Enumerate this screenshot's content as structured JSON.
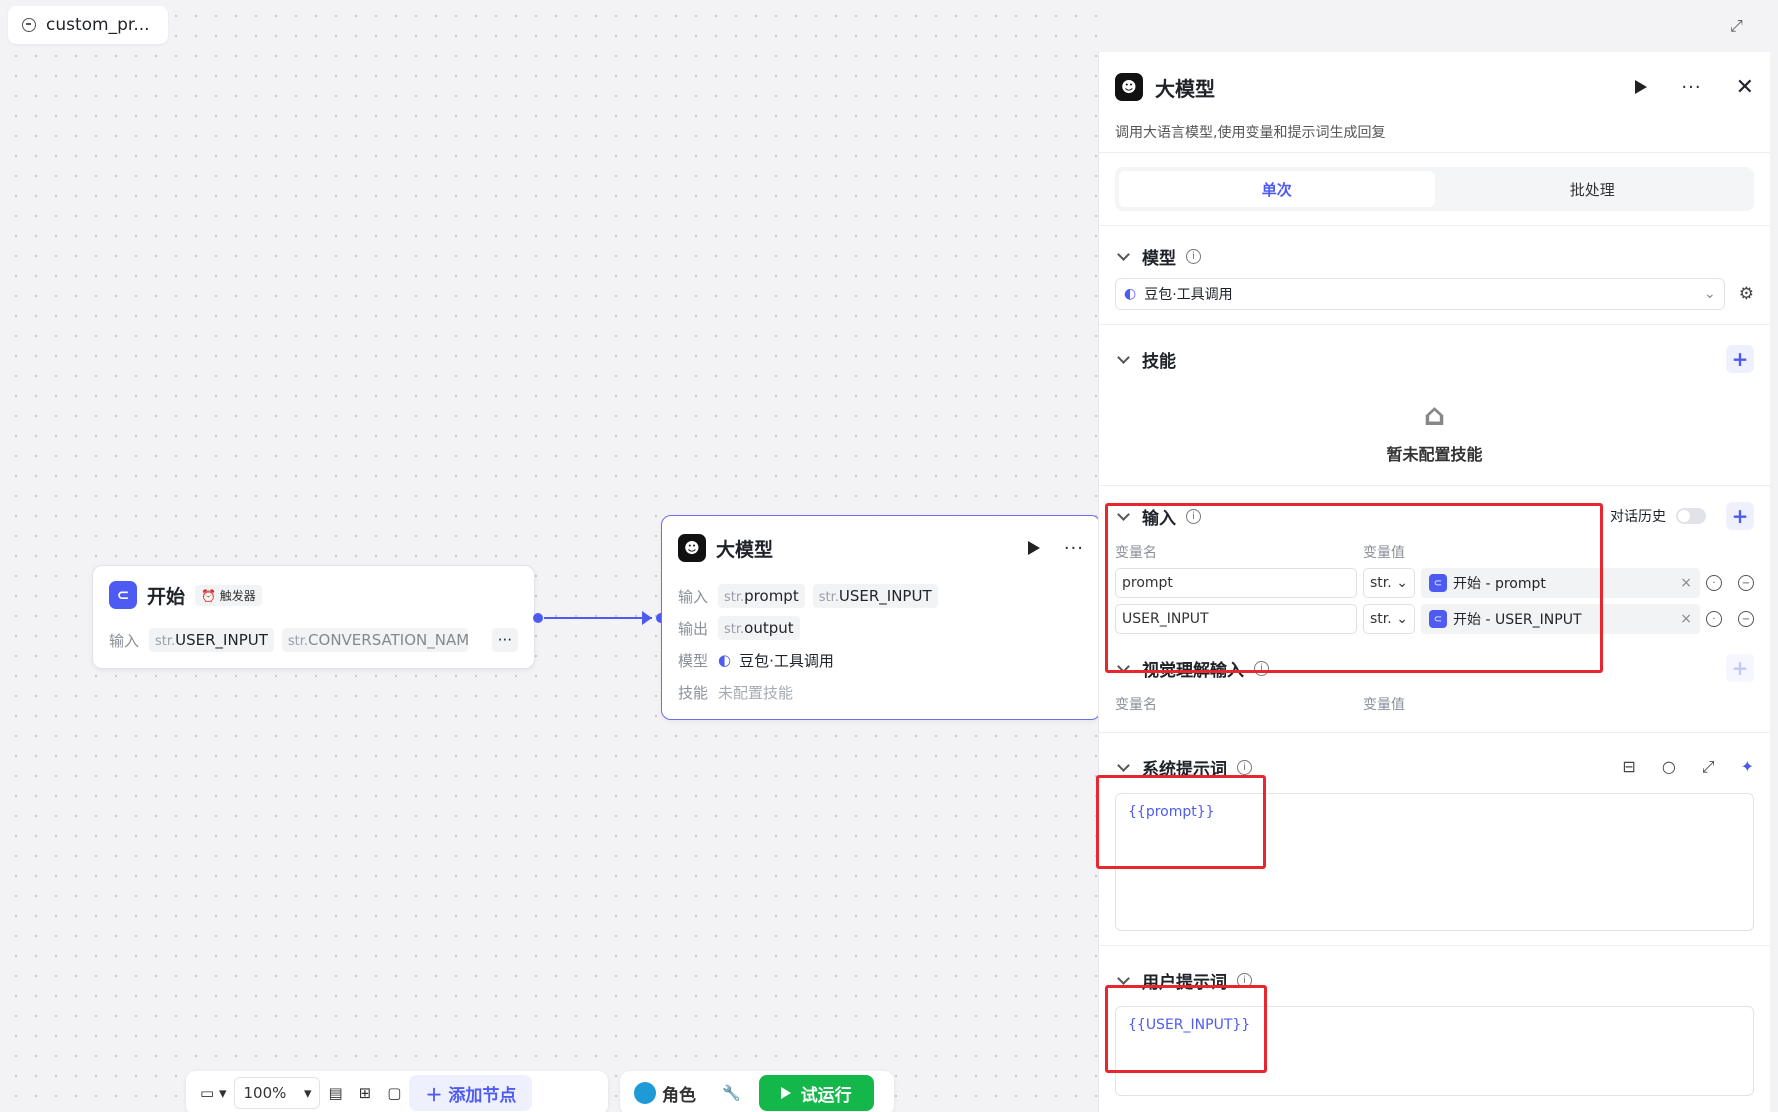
{
  "window": {
    "tab_title": "custom_pr..."
  },
  "start_node": {
    "title": "开始",
    "badge": "触发器",
    "input_label": "输入",
    "inputs": [
      {
        "type": "str.",
        "name": "USER_INPUT"
      },
      {
        "type": "str.",
        "name": "CONVERSATION_NAM"
      }
    ]
  },
  "llm_node": {
    "title": "大模型",
    "input_label": "输入",
    "inputs": [
      {
        "type": "str.",
        "name": "prompt"
      },
      {
        "type": "str.",
        "name": "USER_INPUT"
      }
    ],
    "output_label": "输出",
    "output": {
      "type": "str.",
      "name": "output"
    },
    "model_label": "模型",
    "model_value": "豆包·工具调用",
    "skill_label": "技能",
    "skill_value": "未配置技能"
  },
  "toolbar": {
    "zoom": "100%",
    "add_node": "添加节点",
    "role": "角色",
    "trial_run": "试运行"
  },
  "panel": {
    "title": "大模型",
    "description": "调用大语言模型,使用变量和提示词生成回复",
    "tabs": [
      {
        "label": "单次",
        "active": true
      },
      {
        "label": "批处理",
        "active": false
      }
    ],
    "model": {
      "heading": "模型",
      "value": "豆包·工具调用"
    },
    "skills": {
      "heading": "技能",
      "empty": "暂未配置技能"
    },
    "inputs": {
      "heading": "输入",
      "history_label": "对话历史",
      "col_name": "变量名",
      "col_value": "变量值",
      "rows": [
        {
          "name": "prompt",
          "type": "str.",
          "ref": "开始 - prompt"
        },
        {
          "name": "USER_INPUT",
          "type": "str.",
          "ref": "开始 - USER_INPUT"
        }
      ]
    },
    "vision": {
      "heading": "视觉理解输入",
      "col_name": "变量名",
      "col_value": "变量值"
    },
    "system_prompt": {
      "heading": "系统提示词",
      "value": "{{prompt}}"
    },
    "user_prompt": {
      "heading": "用户提示词",
      "value": "{{USER_INPUT}}"
    }
  },
  "colors": {
    "accent": "#4e5bf2",
    "run": "#14b84a",
    "highlight": "#e8262d"
  }
}
